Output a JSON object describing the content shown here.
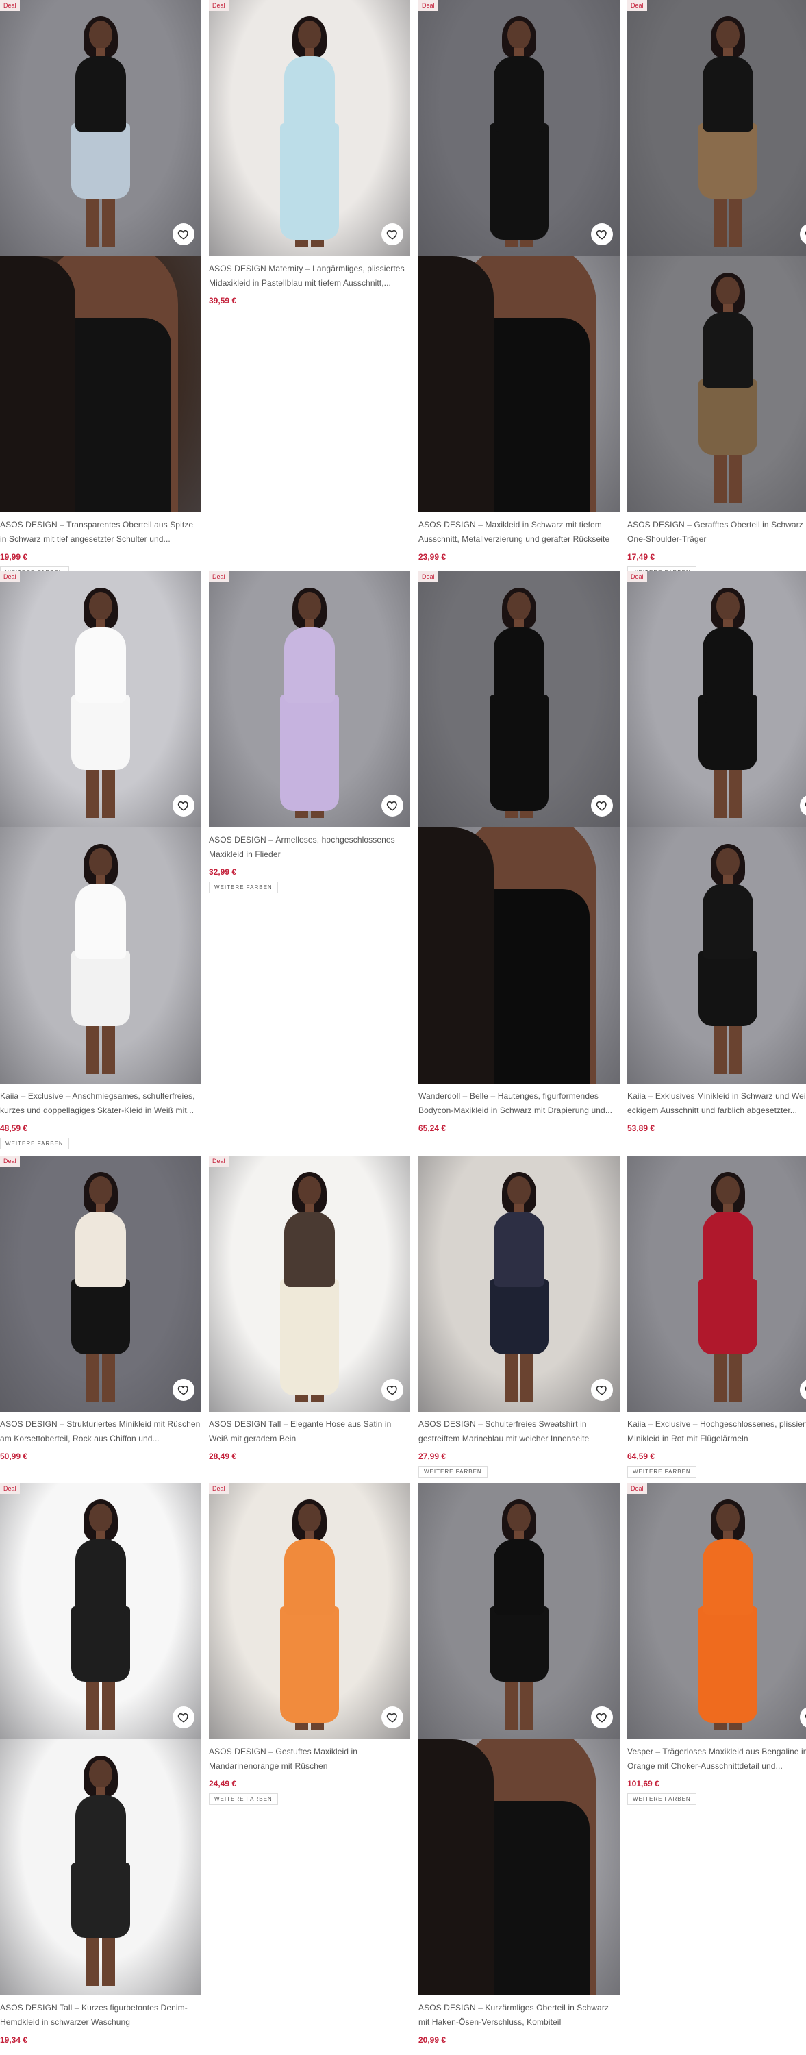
{
  "labels": {
    "deal": "Deal",
    "more_colors": "WEITERE FARBEN"
  },
  "colors": {
    "price": "#c4203a",
    "deal_bg": "#f4e9e9"
  },
  "products": [
    {
      "title": "ASOS DESIGN – Transparentes Oberteil aus Spitze in Schwarz mit tief angesetzter Schulter und...",
      "price": "19,99 €",
      "deal": true,
      "more_colors": true
    },
    {
      "title": "ASOS DESIGN Maternity – Langärmliges, plissiertes Midaxikleid in Pastellblau mit tiefem Ausschnitt,...",
      "price": "39,59 €",
      "deal": true,
      "more_colors": false
    },
    {
      "title": "ASOS DESIGN – Maxikleid in Schwarz mit tiefem Ausschnitt, Metallverzierung und gerafter Rückseite",
      "price": "23,99 €",
      "deal": true,
      "more_colors": false
    },
    {
      "title": "ASOS DESIGN – Gerafftes Oberteil in Schwarz mit One-Shoulder-Träger",
      "price": "17,49 €",
      "deal": true,
      "more_colors": true
    },
    {
      "title": "Kaiia – Exclusive – Anschmiegsames, schulterfreies, kurzes und doppellagiges Skater-Kleid in Weiß mit...",
      "price": "48,59 €",
      "deal": true,
      "more_colors": true
    },
    {
      "title": "ASOS DESIGN – Ärmelloses, hochgeschlossenes Maxikleid in Flieder",
      "price": "32,99 €",
      "deal": true,
      "more_colors": true
    },
    {
      "title": "Wanderdoll – Belle – Hautenges, figurformendes Bodycon-Maxikleid in Schwarz mit Drapierung und...",
      "price": "65,24 €",
      "deal": true,
      "more_colors": false
    },
    {
      "title": "Kaiia – Exklusives Minikleid in Schwarz und Weiß mit eckigem Ausschnitt und farblich abgesetzter...",
      "price": "53,89 €",
      "deal": true,
      "more_colors": false
    },
    {
      "title": "ASOS DESIGN – Strukturiertes Minikleid mit Rüschen am Korsettoberteil, Rock aus Chiffon und...",
      "price": "50,99 €",
      "deal": true,
      "more_colors": false
    },
    {
      "title": "ASOS DESIGN Tall – Elegante Hose aus Satin in Weiß mit geradem Bein",
      "price": "28,49 €",
      "deal": true,
      "more_colors": false
    },
    {
      "title": "ASOS DESIGN – Schulterfreies Sweatshirt in gestreiftem Marineblau mit weicher Innenseite",
      "price": "27,99 €",
      "deal": false,
      "more_colors": true
    },
    {
      "title": "Kaiia – Exclusive – Hochgeschlossenes, plissiertes Minikleid in Rot mit Flügelärmeln",
      "price": "64,59 €",
      "deal": false,
      "more_colors": true
    },
    {
      "title": "ASOS DESIGN Tall – Kurzes figurbetontes Denim-Hemdkleid in schwarzer Waschung",
      "price": "19,34 €",
      "deal": true,
      "more_colors": false
    },
    {
      "title": "ASOS DESIGN – Gestuftes Maxikleid in Mandarinenorange mit Rüschen",
      "price": "24,49 €",
      "deal": true,
      "more_colors": true
    },
    {
      "title": "ASOS DESIGN – Kurzärmliges Oberteil in Schwarz mit Haken-Ösen-Verschluss, Kombiteil",
      "price": "20,99 €",
      "deal": false,
      "more_colors": false
    },
    {
      "title": "Vesper – Trägerloses Maxikleid aus Bengaline in Orange mit Choker-Ausschnittdetail und...",
      "price": "101,69 €",
      "deal": true,
      "more_colors": true
    }
  ]
}
